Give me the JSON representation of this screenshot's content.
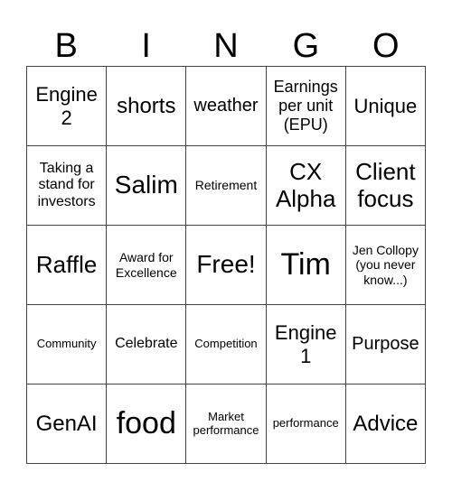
{
  "header": {
    "letters": [
      "B",
      "I",
      "N",
      "G",
      "O"
    ]
  },
  "cells": [
    [
      "Engine 2",
      "shorts",
      "weather",
      "Earnings per unit (EPU)",
      "Unique"
    ],
    [
      "Taking a stand for investors",
      "Salim",
      "Retirement",
      "CX Alpha",
      "Client focus"
    ],
    [
      "Raffle",
      "Award for Excellence",
      "Free!",
      "Tim",
      "Jen Collopy (you never know...)"
    ],
    [
      "Community",
      "Celebrate",
      "Competition",
      "Engine 1",
      "Purpose"
    ],
    [
      "GenAI",
      "food",
      "Market performance",
      "performance",
      "Advice"
    ]
  ]
}
